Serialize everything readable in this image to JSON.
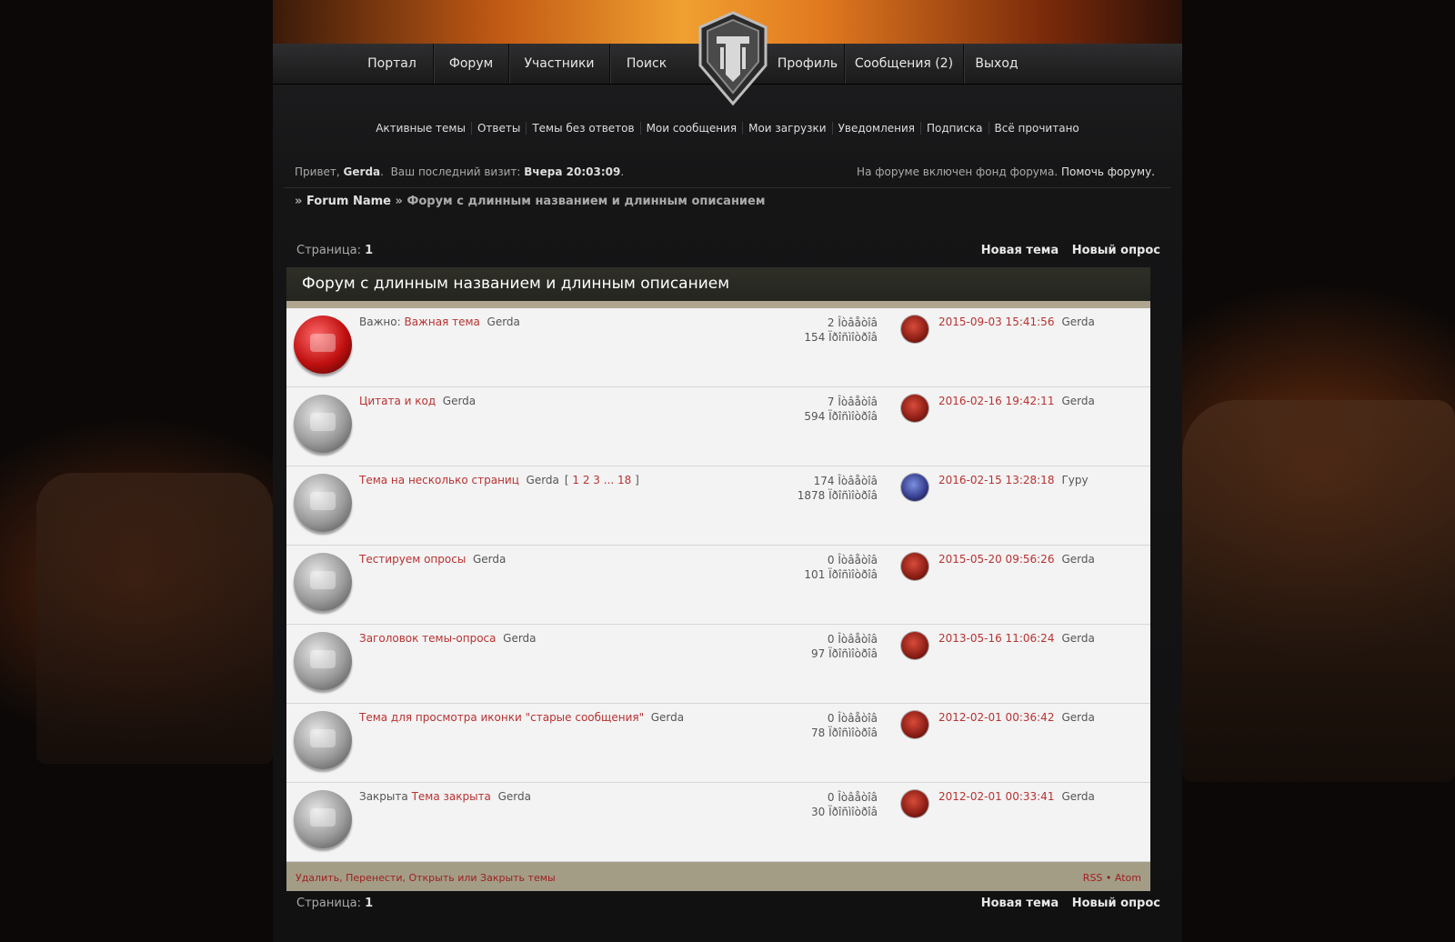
{
  "nav": {
    "items": [
      "Портал",
      "Форум",
      "Участники",
      "Поиск",
      "Профиль",
      "Сообщения (2)",
      "Выход"
    ]
  },
  "subnav": {
    "items": [
      "Активные темы",
      "Ответы",
      "Темы без ответов",
      "Мои сообщения",
      "Мои загрузки",
      "Уведомления",
      "Подписка",
      "Всё прочитано"
    ]
  },
  "greeting": {
    "prefix": "Привет,",
    "user": "Gerda",
    "visit_label": "Ваш последний визит:",
    "visit_time": "Вчера 20:03:09"
  },
  "fund": {
    "text": "На форуме включен фонд форума.",
    "link": "Помочь форуму."
  },
  "breadcrumb": {
    "sep": "»",
    "home": "Forum Name",
    "current": "Форум с длинным названием и длинным описанием"
  },
  "pager": {
    "label": "Страница:",
    "page": "1"
  },
  "actions": {
    "new_topic": "Новая тема",
    "new_poll": "Новый опрос"
  },
  "forum_title": "Форум с длинным названием и длинным описанием",
  "topics": [
    {
      "prefix": "Важно:",
      "title": "Важная тема",
      "author": "Gerda",
      "pages": "",
      "replies": "2 Îòâåòîâ",
      "views": "154 Ïðîñìîòðîâ",
      "last_date": "2015-09-03 15:41:56",
      "last_user": "Gerda",
      "icon": "sticky-topic-icon"
    },
    {
      "prefix": "",
      "title": "Цитата и код",
      "author": "Gerda",
      "pages": "",
      "replies": "7 Îòâåòîâ",
      "views": "594 Ïðîñìîòðîâ",
      "last_date": "2016-02-16 19:42:11",
      "last_user": "Gerda",
      "icon": "topic-icon"
    },
    {
      "prefix": "",
      "title": "Тема на несколько страниц",
      "author": "Gerda",
      "pages": "1 2 3 ... 18",
      "replies": "174 Îòâåòîâ",
      "views": "1878 Ïðîñìîòðîâ",
      "last_date": "2016-02-15 13:28:18",
      "last_user": "Гуру",
      "icon": "topic-icon"
    },
    {
      "prefix": "",
      "title": "Тестируем опросы",
      "author": "Gerda",
      "pages": "",
      "replies": "0 Îòâåòîâ",
      "views": "101 Ïðîñìîòðîâ",
      "last_date": "2015-05-20 09:56:26",
      "last_user": "Gerda",
      "icon": "topic-icon"
    },
    {
      "prefix": "",
      "title": "Заголовок темы-опроса",
      "author": "Gerda",
      "pages": "",
      "replies": "0 Îòâåòîâ",
      "views": "97 Ïðîñìîòðîâ",
      "last_date": "2013-05-16 11:06:24",
      "last_user": "Gerda",
      "icon": "topic-icon"
    },
    {
      "prefix": "",
      "title": "Тема для просмотра иконки \"старые сообщения\"",
      "author": "Gerda",
      "pages": "",
      "replies": "0 Îòâåòîâ",
      "views": "78 Ïðîñìîòðîâ",
      "last_date": "2012-02-01 00:36:42",
      "last_user": "Gerda",
      "icon": "topic-icon"
    },
    {
      "prefix": "Закрыта",
      "title": "Тема закрыта",
      "author": "Gerda",
      "pages": "",
      "replies": "0 Îòâåòîâ",
      "views": "30 Ïðîñìîòðîâ",
      "last_date": "2012-02-01 00:33:41",
      "last_user": "Gerda",
      "icon": "topic-icon"
    }
  ],
  "footer": {
    "mod_actions": "Удалить, Перенести, Открыть или Закрыть темы",
    "rss": "RSS",
    "dot": "•",
    "atom": "Atom"
  }
}
